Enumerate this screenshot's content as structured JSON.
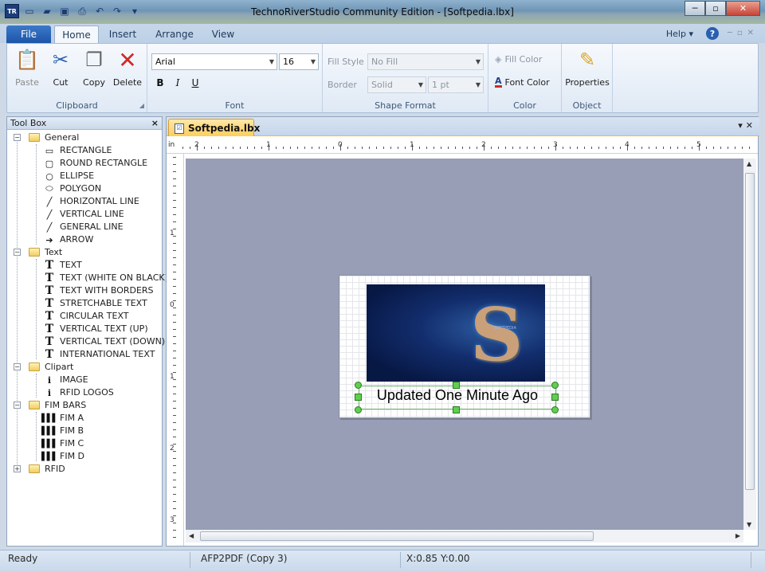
{
  "window": {
    "title": "TechnoRiverStudio Community Edition - [Softpedia.lbx]",
    "app_icon": "TR"
  },
  "ribbon_tabs": {
    "file": "File",
    "home": "Home",
    "insert": "Insert",
    "arrange": "Arrange",
    "view": "View",
    "help": "Help ▾"
  },
  "clipboard": {
    "paste": "Paste",
    "cut": "Cut",
    "copy": "Copy",
    "delete": "Delete",
    "group": "Clipboard"
  },
  "font": {
    "family": "Arial",
    "size": "16",
    "bold": "B",
    "italic": "I",
    "underline": "U",
    "group": "Font"
  },
  "shape_format": {
    "fill_style_label": "Fill Style",
    "fill_style_value": "No Fill",
    "border_label": "Border",
    "border_value": "Solid",
    "border_width": "1 pt",
    "group": "Shape Format"
  },
  "color": {
    "fill": "Fill Color",
    "font": "Font Color",
    "group": "Color"
  },
  "object": {
    "properties": "Properties",
    "group": "Object"
  },
  "toolbox": {
    "title": "Tool Box",
    "general": {
      "label": "General",
      "items": [
        "RECTANGLE",
        "ROUND RECTANGLE",
        "ELLIPSE",
        "POLYGON",
        "HORIZONTAL LINE",
        "VERTICAL LINE",
        "GENERAL LINE",
        "ARROW"
      ]
    },
    "text": {
      "label": "Text",
      "items": [
        "TEXT",
        "TEXT (WHITE ON BLACK)",
        "TEXT WITH BORDERS",
        "STRETCHABLE TEXT",
        "CIRCULAR TEXT",
        "VERTICAL TEXT (UP)",
        "VERTICAL TEXT (DOWN)",
        "INTERNATIONAL TEXT"
      ]
    },
    "clipart": {
      "label": "Clipart",
      "items": [
        "IMAGE",
        "RFID LOGOS"
      ]
    },
    "fim": {
      "label": "FIM BARS",
      "items": [
        "FIM A",
        "FIM B",
        "FIM C",
        "FIM D"
      ]
    },
    "rfid": {
      "label": "RFID"
    }
  },
  "document": {
    "tab": "Softpedia.lbx",
    "ruler_unit": "in",
    "h_ruler_labels": [
      "2",
      "1",
      "0",
      "1",
      "2",
      "3",
      "4",
      "5"
    ],
    "v_ruler_labels": [
      "1",
      "0",
      "1",
      "2",
      "3"
    ],
    "label_text": "Updated One Minute Ago",
    "image_caption": "SOFTPEDIA"
  },
  "status": {
    "state": "Ready",
    "printer": "AFP2PDF (Copy 3)",
    "x": "X:0.85",
    "y": "Y:0.00"
  }
}
